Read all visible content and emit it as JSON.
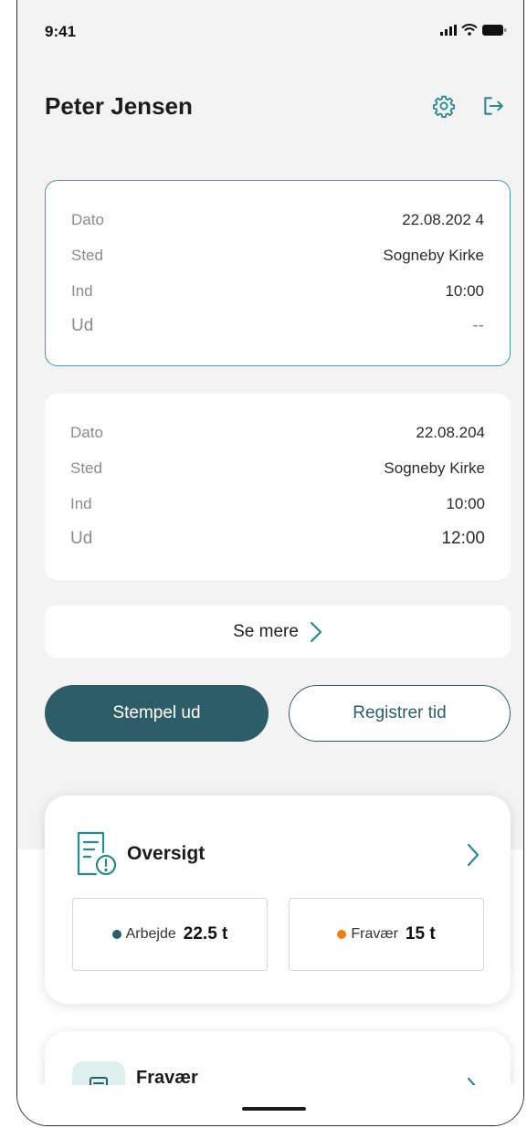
{
  "status_bar": {
    "time": "9:41"
  },
  "header": {
    "user_name": "Peter Jensen"
  },
  "icons": {
    "settings": "gear-icon",
    "logout": "logout-icon",
    "chevron": "chevron-right-icon",
    "overview": "document-alert-icon",
    "absence": "document-icon"
  },
  "entries": [
    {
      "active": true,
      "rows": [
        {
          "label": "Dato",
          "value": "22.08.202  4"
        },
        {
          "label": "Sted",
          "value": "Sogneby Kirke"
        },
        {
          "label": "Ind",
          "value": "10:00"
        },
        {
          "label": "Ud",
          "value": "--"
        }
      ]
    },
    {
      "active": false,
      "rows": [
        {
          "label": "Dato",
          "value": "22.08.204"
        },
        {
          "label": "Sted",
          "value": "Sogneby Kirke"
        },
        {
          "label": "Ind",
          "value": "10:00"
        },
        {
          "label": "Ud",
          "value": "12:00"
        }
      ]
    }
  ],
  "see_more": {
    "label": "Se mere"
  },
  "actions": {
    "primary": "Stempel ud",
    "secondary": "Registrer tid"
  },
  "overview": {
    "title": "Oversigt",
    "stats": [
      {
        "label": "Arbejde",
        "value": "22.5 t",
        "color": "#2d5e67"
      },
      {
        "label": "Fravær",
        "value": "15 t",
        "color": "#f07d12"
      }
    ]
  },
  "absence": {
    "title": "Fravær"
  },
  "colors": {
    "accent": "#2d5e67",
    "teal": "#4a9a9a",
    "orange": "#f07d12"
  }
}
